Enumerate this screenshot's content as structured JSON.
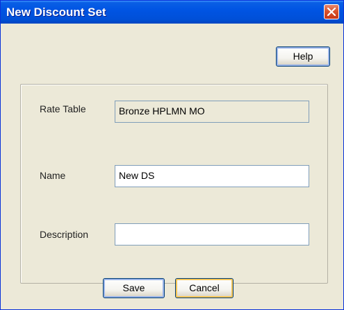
{
  "window": {
    "title": "New Discount Set"
  },
  "buttons": {
    "help_label": "Help",
    "save_label": "Save",
    "cancel_label": "Cancel"
  },
  "form": {
    "rate_table": {
      "label": "Rate Table",
      "value": "Bronze HPLMN MO"
    },
    "name": {
      "label": "Name",
      "value": "New DS"
    },
    "description": {
      "label": "Description",
      "value": ""
    }
  },
  "colors": {
    "titlebar": "#0054e3",
    "close_button": "#d9522c",
    "dialog_background": "#ece9d8",
    "field_border": "#7f9db9"
  }
}
